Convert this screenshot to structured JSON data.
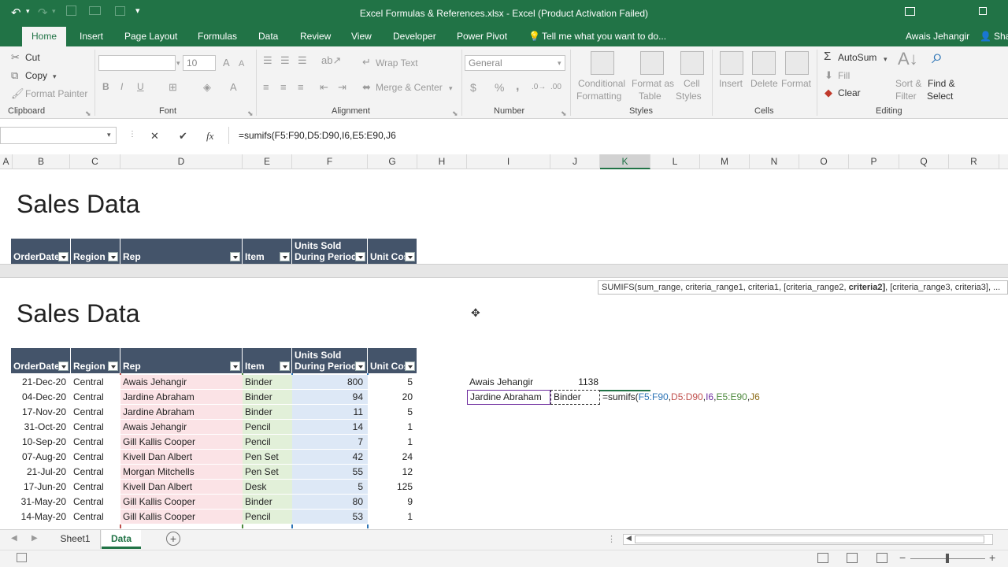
{
  "window": {
    "title": "Excel Formulas & References.xlsx - Excel (Product Activation Failed)",
    "ribbon_display_icon": "ribbon-display-icon",
    "restore_icon": "restore-icon"
  },
  "tabs": [
    "Home",
    "Insert",
    "Page Layout",
    "Formulas",
    "Data",
    "Review",
    "View",
    "Developer",
    "Power Pivot"
  ],
  "tell_me": "Tell me what you want to do...",
  "user": "Awais Jehangir",
  "share": "Sha",
  "ribbon": {
    "clipboard": {
      "cut": "Cut",
      "copy": "Copy",
      "format_painter": "Format Painter",
      "label": "Clipboard"
    },
    "font": {
      "size": "10",
      "label": "Font",
      "bold": "B",
      "italic": "I",
      "underline": "U"
    },
    "alignment": {
      "wrap_text": "Wrap Text",
      "merge_center": "Merge & Center",
      "label": "Alignment"
    },
    "number": {
      "format": "General",
      "currency": "$",
      "percent": "%",
      "comma": ",",
      "label": "Number"
    },
    "styles": {
      "conditional_1": "Conditional",
      "conditional_2": "Formatting",
      "format_table_1": "Format as",
      "format_table_2": "Table",
      "cell_styles_1": "Cell",
      "cell_styles_2": "Styles",
      "label": "Styles"
    },
    "cells": {
      "insert": "Insert",
      "delete": "Delete",
      "format": "Format",
      "label": "Cells"
    },
    "editing": {
      "autosum": "AutoSum",
      "fill": "Fill",
      "clear": "Clear",
      "sort_1": "Sort &",
      "sort_2": "Filter",
      "find_1": "Find &",
      "find_2": "Select",
      "label": "Editing"
    }
  },
  "formula_bar": {
    "name_box": "",
    "cancel": "✕",
    "enter": "✔",
    "fx": "fx",
    "formula": "=sumifs(F5:F90,D5:D90,I6,E5:E90,J6"
  },
  "columns": [
    "A",
    "B",
    "C",
    "D",
    "E",
    "F",
    "G",
    "H",
    "I",
    "J",
    "K",
    "L",
    "M",
    "N",
    "O",
    "P",
    "Q",
    "R"
  ],
  "selected_column": "K",
  "sheet": {
    "title": "Sales Data",
    "headers": [
      "OrderDate",
      "Region",
      "Rep",
      "Item",
      "Units Sold During Period",
      "Unit Cost"
    ],
    "header_units_1": "Units Sold",
    "header_units_2": "During Period",
    "rows": [
      [
        "21-Dec-20",
        "Central",
        "Awais Jehangir",
        "Binder",
        "800",
        "5"
      ],
      [
        "04-Dec-20",
        "Central",
        "Jardine Abraham",
        "Binder",
        "94",
        "20"
      ],
      [
        "17-Nov-20",
        "Central",
        "Jardine Abraham",
        "Binder",
        "11",
        "5"
      ],
      [
        "31-Oct-20",
        "Central",
        "Awais Jehangir",
        "Pencil",
        "14",
        "1"
      ],
      [
        "10-Sep-20",
        "Central",
        "Gill Kallis Cooper",
        "Pencil",
        "7",
        "1"
      ],
      [
        "07-Aug-20",
        "Central",
        "Kivell Dan Albert",
        "Pen Set",
        "42",
        "24"
      ],
      [
        "21-Jul-20",
        "Central",
        "Morgan Mitchells",
        "Pen Set",
        "55",
        "12"
      ],
      [
        "17-Jun-20",
        "Central",
        "Kivell Dan Albert",
        "Desk",
        "5",
        "125"
      ],
      [
        "31-May-20",
        "Central",
        "Gill Kallis Cooper",
        "Binder",
        "80",
        "9"
      ],
      [
        "14-May-20",
        "Central",
        "Gill Kallis Cooper",
        "Pencil",
        "53",
        "1"
      ]
    ],
    "lookup": {
      "row1_name": "Awais Jehangir",
      "row1_value": "1138",
      "row2_name": "Jardine Abraham",
      "row2_item": "Binder",
      "formula_parts": [
        "=sumifs(",
        "F5:F90",
        ",",
        "D5:D90",
        ",",
        "I6",
        ",",
        "E5:E90",
        ",",
        "J6"
      ]
    },
    "tooltip_parts": [
      "SUMIFS(sum_range, criteria_range1, criteria1, [criteria_range2, ",
      "criteria2]",
      ", [criteria_range3, criteria3], ..."
    ]
  },
  "sheet_tabs": [
    "Sheet1",
    "Data"
  ],
  "active_sheet": "Data",
  "colors": {
    "excel_green": "#217346",
    "table_header": "#44546a",
    "rep_fill": "#fbe3e6",
    "item_fill": "#e2f0d9",
    "units_fill": "#dde8f6"
  }
}
